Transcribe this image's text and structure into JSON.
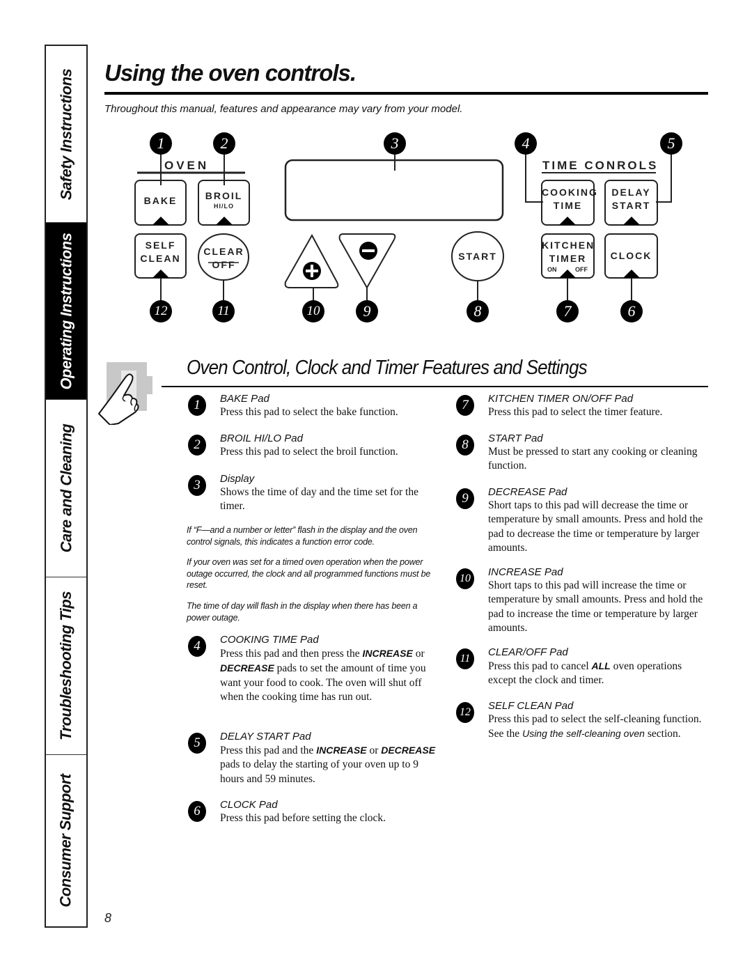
{
  "sidebar": {
    "tabs": [
      {
        "label": "Safety Instructions",
        "active": false
      },
      {
        "label": "Operating Instructions",
        "active": true
      },
      {
        "label": "Care and Cleaning",
        "active": false
      },
      {
        "label": "Troubleshooting Tips",
        "active": false
      },
      {
        "label": "Consumer Support",
        "active": false
      }
    ]
  },
  "header": {
    "title": "Using the oven controls.",
    "subtitle": "Throughout this manual, features and appearance may vary from your model."
  },
  "diagram": {
    "oven_group_label": "OVEN",
    "time_group_label": "TIME CONROLS",
    "pads": {
      "bake": "BAKE",
      "broil": "BROIL",
      "broil_sub": "HI/LO",
      "self_clean_1": "SELF",
      "self_clean_2": "CLEAN",
      "clear_1": "CLEAR",
      "clear_2": "OFF",
      "start": "START",
      "cooking_time_1": "COOKING",
      "cooking_time_2": "TIME",
      "delay_start_1": "DELAY",
      "delay_start_2": "START",
      "kitchen_timer_1": "KITCHEN",
      "kitchen_timer_2": "TIMER",
      "kitchen_timer_on": "ON",
      "kitchen_timer_off": "OFF",
      "clock": "CLOCK"
    },
    "callouts": [
      "1",
      "2",
      "3",
      "4",
      "5",
      "6",
      "7",
      "8",
      "9",
      "10",
      "11",
      "12"
    ],
    "increase_icon": "plus-icon",
    "decrease_icon": "minus-icon"
  },
  "section": {
    "title": "Oven Control, Clock and Timer Features and Settings",
    "icon": "pointing-hand-icon"
  },
  "features_left": [
    {
      "num": "1",
      "name": "BAKE Pad",
      "desc": "Press this pad to select the bake function."
    },
    {
      "num": "2",
      "name": "BROIL HI/LO Pad",
      "desc": "Press this pad to select the broil function."
    },
    {
      "num": "3",
      "name": "Display",
      "desc": "Shows the time of day and the time set for the timer."
    },
    {
      "num": "4",
      "name": "COOKING TIME Pad",
      "desc_parts": [
        "Press this pad and then press the ",
        "INCREASE",
        " or ",
        "DECREASE",
        " pads to set the amount of time you want your food to cook. The oven will shut off when the cooking time has run out."
      ]
    },
    {
      "num": "5",
      "name": "DELAY START Pad",
      "desc_parts": [
        "Press this pad and the ",
        "INCREASE",
        " or ",
        "DECREASE",
        " pads to delay the starting of your oven up to 9 hours and 59 minutes."
      ]
    },
    {
      "num": "6",
      "name": "CLOCK Pad",
      "desc": "Press this pad before setting the clock."
    }
  ],
  "notes": [
    "If “F—and a number or letter” flash in the display and the oven control signals, this indicates a function error code.",
    "If your oven was set for a timed oven operation when the power outage occurred, the clock and all programmed functions must be reset.",
    "The time of day will flash in the display when there has been a power outage."
  ],
  "features_right": [
    {
      "num": "7",
      "name": "KITCHEN TIMER ON/OFF Pad",
      "desc": "Press this pad to select the timer feature."
    },
    {
      "num": "8",
      "name": "START Pad",
      "desc": "Must be pressed to start any cooking or cleaning function."
    },
    {
      "num": "9",
      "name": "DECREASE Pad",
      "desc": "Short taps to this pad will decrease the time or temperature by small amounts. Press and hold the pad to decrease the time or temperature by larger amounts."
    },
    {
      "num": "10",
      "name": "INCREASE Pad",
      "desc": "Short taps to this pad will increase the time or temperature by small amounts. Press and hold the pad to increase the time or temperature by larger amounts."
    },
    {
      "num": "11",
      "name": "CLEAR/OFF Pad",
      "desc_parts": [
        "Press this pad to cancel ",
        "ALL",
        " oven operations except the clock and timer."
      ]
    },
    {
      "num": "12",
      "name": "SELF CLEAN Pad",
      "desc_parts": [
        "Press this pad to select the self-cleaning function. See the ",
        "Using the self-cleaning oven",
        " section."
      ]
    }
  ],
  "page_number": "8"
}
